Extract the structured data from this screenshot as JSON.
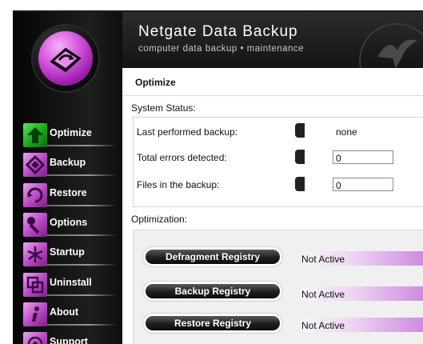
{
  "app": {
    "title": "Netgate Data Backup",
    "subtitle": "computer data backup • maintenance"
  },
  "nav": [
    {
      "label": "Optimize",
      "icon": "optimize-arrow-icon",
      "active": true
    },
    {
      "label": "Backup",
      "icon": "backup-icon"
    },
    {
      "label": "Restore",
      "icon": "restore-icon"
    },
    {
      "label": "Options",
      "icon": "wrench-icon"
    },
    {
      "label": "Startup",
      "icon": "startup-icon"
    },
    {
      "label": "Uninstall",
      "icon": "uninstall-icon"
    },
    {
      "label": "About",
      "icon": "info-icon"
    },
    {
      "label": "Support",
      "icon": "support-icon"
    }
  ],
  "page": {
    "title": "Optimize"
  },
  "system_status": {
    "label": "System Status:",
    "rows": [
      {
        "label": "Last performed backup:",
        "value": "none"
      },
      {
        "label": "Total errors detected:",
        "value": "0"
      },
      {
        "label": "Files in the backup:",
        "value": "0"
      }
    ]
  },
  "optimization": {
    "label": "Optimization:",
    "items": [
      {
        "button": "Defragment Registry",
        "status": "Not Active"
      },
      {
        "button": "Backup Registry",
        "status": "Not Active"
      },
      {
        "button": "Restore Registry",
        "status": "Not Active"
      }
    ]
  },
  "colors": {
    "accent": "#b645c2",
    "active": "#18a818",
    "sidebar": "#111111"
  }
}
